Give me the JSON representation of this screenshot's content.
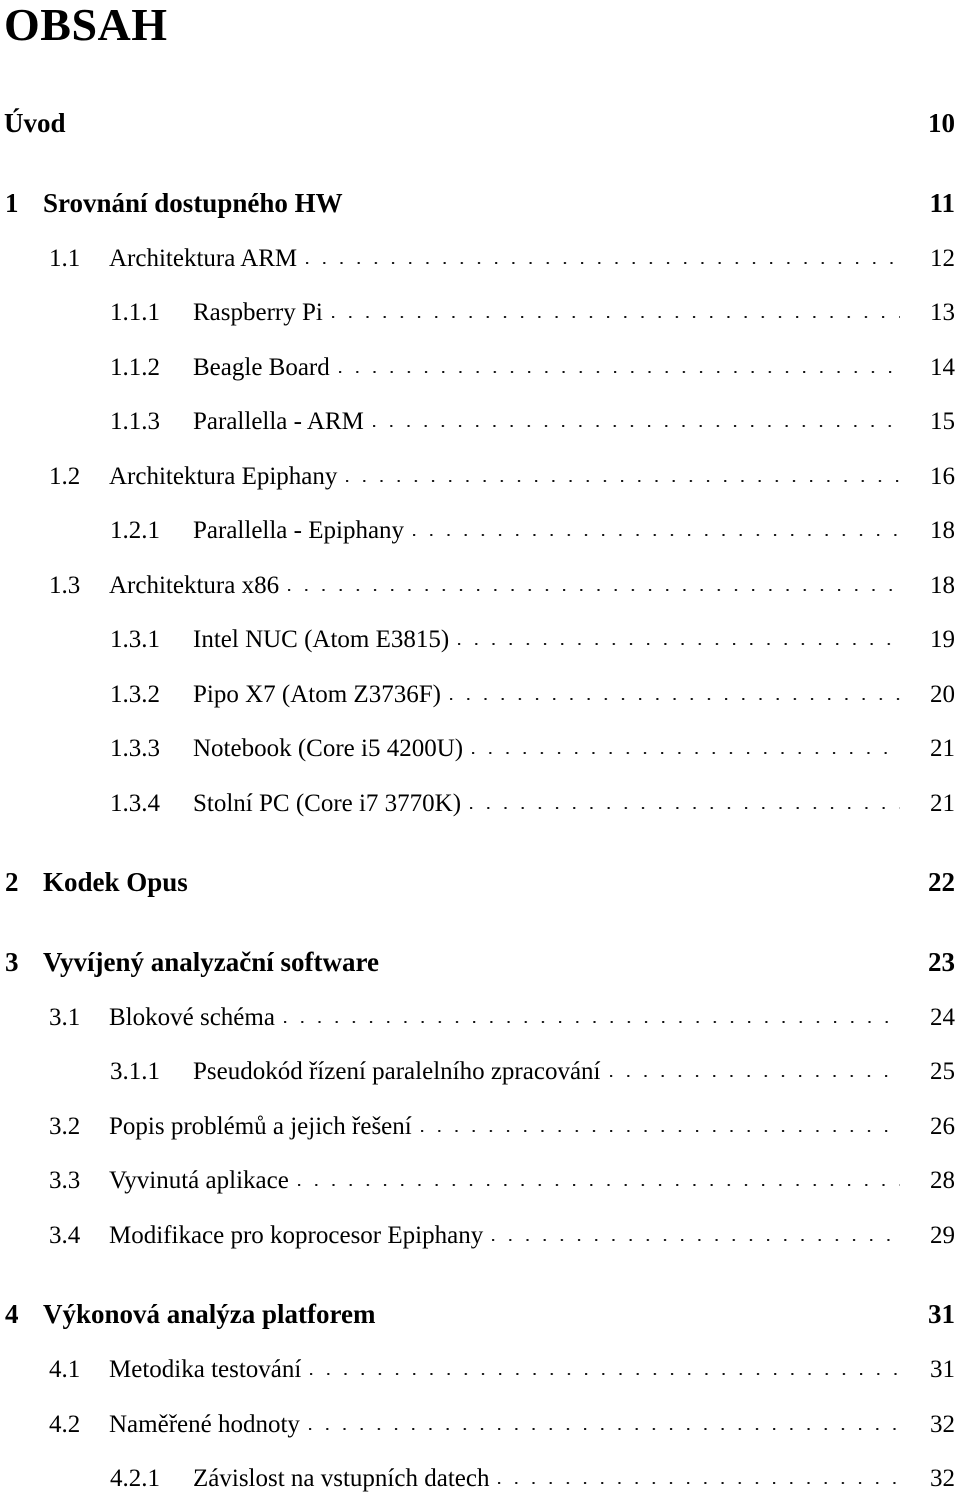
{
  "document": {
    "title": "OBSAH"
  },
  "entries": [
    {
      "level": 0,
      "number": "",
      "label": "Úvod",
      "page": "10",
      "leader": false
    },
    {
      "level": 1,
      "number": "1",
      "label": "Srovnání dostupného HW",
      "page": "11",
      "leader": false
    },
    {
      "level": 2,
      "number": "1.1",
      "label": "Architektura ARM",
      "page": "12",
      "leader": true
    },
    {
      "level": 3,
      "number": "1.1.1",
      "label": "Raspberry Pi",
      "page": "13",
      "leader": true
    },
    {
      "level": 3,
      "number": "1.1.2",
      "label": "Beagle Board",
      "page": "14",
      "leader": true
    },
    {
      "level": 3,
      "number": "1.1.3",
      "label": "Parallella - ARM",
      "page": "15",
      "leader": true
    },
    {
      "level": 2,
      "number": "1.2",
      "label": "Architektura Epiphany",
      "page": "16",
      "leader": true
    },
    {
      "level": 3,
      "number": "1.2.1",
      "label": "Parallella - Epiphany",
      "page": "18",
      "leader": true
    },
    {
      "level": 2,
      "number": "1.3",
      "label": "Architektura x86",
      "page": "18",
      "leader": true
    },
    {
      "level": 3,
      "number": "1.3.1",
      "label": "Intel NUC (Atom E3815)",
      "page": "19",
      "leader": true
    },
    {
      "level": 3,
      "number": "1.3.2",
      "label": "Pipo X7 (Atom Z3736F)",
      "page": "20",
      "leader": true
    },
    {
      "level": 3,
      "number": "1.3.3",
      "label": "Notebook (Core i5 4200U)",
      "page": "21",
      "leader": true
    },
    {
      "level": 3,
      "number": "1.3.4",
      "label": "Stolní PC (Core i7 3770K)",
      "page": "21",
      "leader": true
    },
    {
      "level": 1,
      "number": "2",
      "label": "Kodek Opus",
      "page": "22",
      "leader": false
    },
    {
      "level": 1,
      "number": "3",
      "label": "Vyvíjený analyzační software",
      "page": "23",
      "leader": false
    },
    {
      "level": 2,
      "number": "3.1",
      "label": "Blokové schéma",
      "page": "24",
      "leader": true
    },
    {
      "level": 3,
      "number": "3.1.1",
      "label": "Pseudokód řízení paralelního zpracování",
      "page": "25",
      "leader": true
    },
    {
      "level": 2,
      "number": "3.2",
      "label": "Popis problémů a jejich řešení",
      "page": "26",
      "leader": true
    },
    {
      "level": 2,
      "number": "3.3",
      "label": "Vyvinutá aplikace",
      "page": "28",
      "leader": true
    },
    {
      "level": 2,
      "number": "3.4",
      "label": "Modifikace pro koprocesor Epiphany",
      "page": "29",
      "leader": true
    },
    {
      "level": 1,
      "number": "4",
      "label": "Výkonová analýza platforem",
      "page": "31",
      "leader": false
    },
    {
      "level": 2,
      "number": "4.1",
      "label": "Metodika testování",
      "page": "31",
      "leader": true
    },
    {
      "level": 2,
      "number": "4.2",
      "label": "Naměřené hodnoty",
      "page": "32",
      "leader": true
    },
    {
      "level": 3,
      "number": "4.2.1",
      "label": "Závislost na vstupních datech",
      "page": "32",
      "leader": true
    }
  ]
}
